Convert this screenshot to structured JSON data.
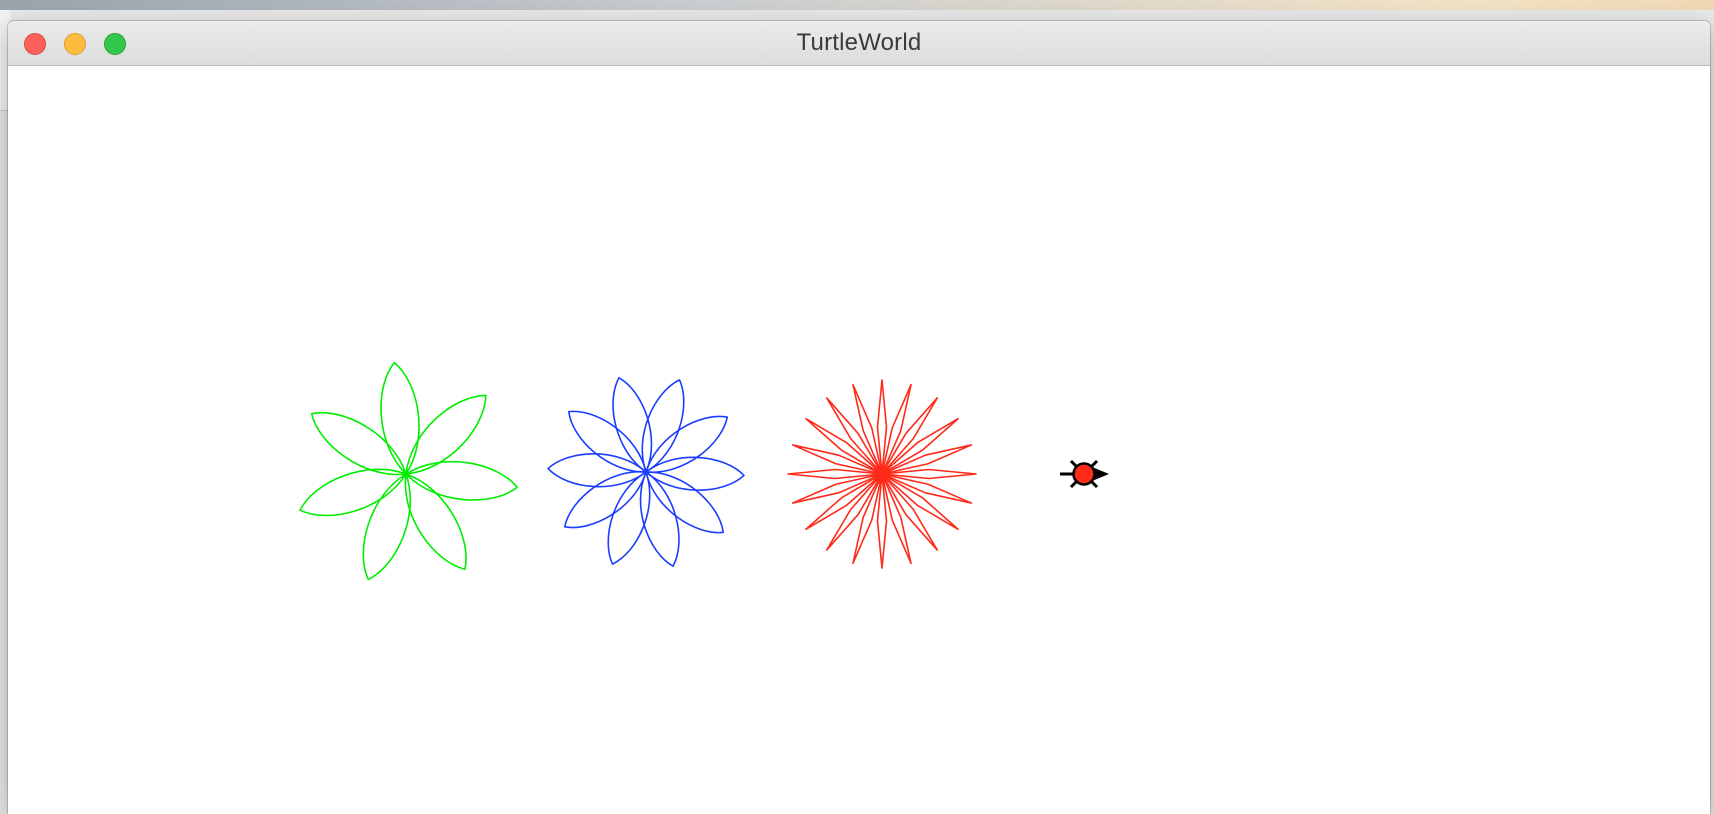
{
  "window": {
    "title": "TurtleWorld",
    "controls": [
      "close",
      "minimize",
      "maximize"
    ]
  },
  "canvas": {
    "background": "#ffffff",
    "drawings": [
      {
        "name": "green-flower",
        "color": "#00ee00",
        "petals": 7,
        "shape": "rounded-petal"
      },
      {
        "name": "blue-flower",
        "color": "#1a3dff",
        "petals": 10,
        "shape": "rounded-petal"
      },
      {
        "name": "red-flower",
        "color": "#ff2a1a",
        "petals": 20,
        "shape": "thin-spike"
      }
    ],
    "turtle": {
      "name": "turtle",
      "body_color": "#ff2a1a",
      "outline_color": "#000000",
      "heading": "east"
    }
  }
}
